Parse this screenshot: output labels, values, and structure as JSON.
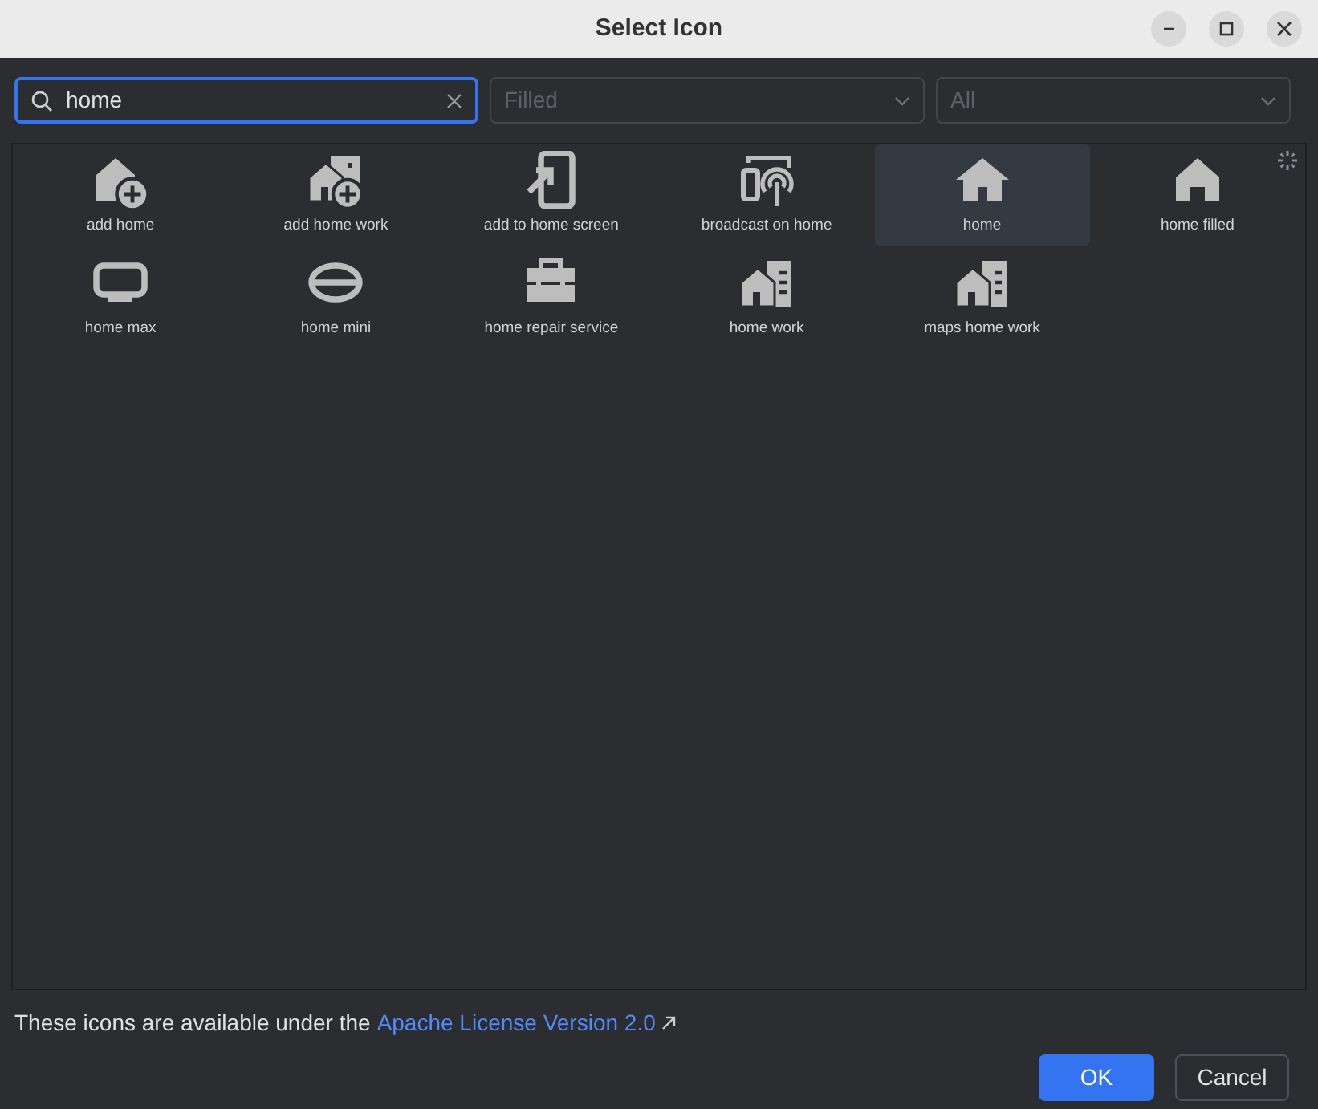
{
  "window": {
    "title": "Select Icon"
  },
  "search": {
    "value": "home"
  },
  "style_dropdown": {
    "value": "Filled"
  },
  "category_dropdown": {
    "value": "All"
  },
  "icons": [
    {
      "label": "add home",
      "kind": "add_home",
      "selected": false
    },
    {
      "label": "add home work",
      "kind": "add_home_work",
      "selected": false
    },
    {
      "label": "add to home screen",
      "kind": "add_to_home_screen",
      "selected": false
    },
    {
      "label": "broadcast on home",
      "kind": "broadcast",
      "selected": false
    },
    {
      "label": "home",
      "kind": "home",
      "selected": true
    },
    {
      "label": "home filled",
      "kind": "home_filled",
      "selected": false
    },
    {
      "label": "home max",
      "kind": "home_max",
      "selected": false
    },
    {
      "label": "home mini",
      "kind": "home_mini",
      "selected": false
    },
    {
      "label": "home repair service",
      "kind": "toolbox",
      "selected": false
    },
    {
      "label": "home work",
      "kind": "home_work",
      "selected": false
    },
    {
      "label": "maps home work",
      "kind": "home_work",
      "selected": false
    }
  ],
  "footer": {
    "text": "These icons are available under the",
    "link": "Apache License Version 2.0"
  },
  "buttons": [
    {
      "label": "OK",
      "kind": "primary"
    },
    {
      "label": "Cancel",
      "kind": "secondary"
    }
  ]
}
